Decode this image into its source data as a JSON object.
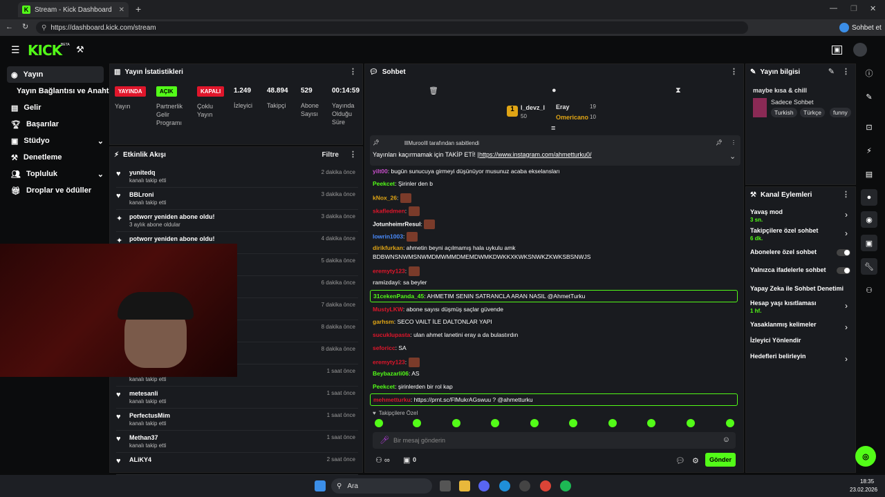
{
  "browser": {
    "tab_title": "Stream - Kick Dashboard",
    "url": "https://dashboard.kick.com/stream",
    "profile_label": "Sohbet et"
  },
  "header": {
    "logo": "KICK",
    "beta": "BETA"
  },
  "nav": {
    "items": [
      {
        "label": "Yayın"
      },
      {
        "label": "Yayın Bağlantısı ve Anahtarı"
      },
      {
        "label": "Gelir"
      },
      {
        "label": "Başarılar"
      },
      {
        "label": "Stüdyo"
      },
      {
        "label": "Denetleme"
      },
      {
        "label": "Topluluk"
      },
      {
        "label": "Droplar ve ödüller"
      }
    ]
  },
  "stats": {
    "title": "Yayın İstatistikleri",
    "b1": "YAYINDA",
    "b2": "AÇIK",
    "b3": "KAPALI",
    "l1": "Yayın",
    "l2": "Partnerlik Gelir Programı",
    "l3": "Çoklu Yayın",
    "v4": "1.249",
    "l4": "İzleyici",
    "v5": "48.894",
    "l5": "Takipçi",
    "v6": "529",
    "l6": "Abone Sayısı",
    "v7": "00:14:59",
    "l7": "Yayında Olduğu Süre"
  },
  "activity": {
    "title": "Etkinlik Akışı",
    "filter": "Filtre",
    "items": [
      {
        "name": "yunitedq",
        "sub": "kanalı takip etti",
        "time": "2 dakika önce"
      },
      {
        "name": "BBLroni",
        "sub": "kanalı takip etti",
        "time": "3 dakika önce"
      },
      {
        "name": "potworr yeniden abone oldu!",
        "sub": "3 aylık abone oldular",
        "time": "3 dakika önce"
      },
      {
        "name": "potworr yeniden abone oldu!",
        "sub": "",
        "time": "4 dakika önce"
      },
      {
        "name": "",
        "sub": "",
        "time": "5 dakika önce"
      },
      {
        "name": "",
        "sub": "",
        "time": "6 dakika önce"
      },
      {
        "name": "",
        "sub": "",
        "time": "7 dakika önce"
      },
      {
        "name": "",
        "sub": "",
        "time": "8 dakika önce"
      },
      {
        "name": "",
        "sub": "",
        "time": "8 dakika önce"
      },
      {
        "name": "",
        "sub": "kanalı takip etti",
        "time": "1 saat önce"
      },
      {
        "name": "metesanli",
        "sub": "kanalı takip etti",
        "time": "1 saat önce"
      },
      {
        "name": "PerfectusMim",
        "sub": "kanalı takip etti",
        "time": "1 saat önce"
      },
      {
        "name": "Methan37",
        "sub": "kanalı takip etti",
        "time": "1 saat önce"
      },
      {
        "name": "ALiKY4",
        "sub": "",
        "time": "2 saat önce"
      }
    ]
  },
  "chat": {
    "title": "Sohbet",
    "top": [
      {
        "name": "l_devz_l",
        "val": "50"
      },
      {
        "name": "Eray",
        "val": "19"
      },
      {
        "name": "Omericano",
        "val": "10"
      }
    ],
    "pin_by": "lllMurooIll tarafından sabitlendi",
    "pin_text": "Yayınları kaçırmamak için TAKİP ETİ! |",
    "pin_link": "https://www.instagram.com/ahmetturku0/",
    "messages": [
      {
        "u": "yilt00",
        "t": "bugün sunucuya girmeyi düşünüyor musunuz acaba ekselansları"
      },
      {
        "u": "Peekcet",
        "t": "Şirinler den b"
      },
      {
        "u": "kNox_26",
        "t": ""
      },
      {
        "u": "skafledmen",
        "t": ""
      },
      {
        "u": "JotunheimrResul",
        "t": ""
      },
      {
        "u": "lowrin1003",
        "t": ""
      },
      {
        "u": "dirikfurkan",
        "t": "ahmetin beyni açılmamış hala uykulu amk"
      },
      {
        "u": "",
        "t": "BDBWNSNWMSNWMDMWMMDMEMDWMKDWKKXKWKSNWKZKWKSBSNWJS"
      },
      {
        "u": "eremyty123",
        "t": ""
      },
      {
        "u": "ramizdayi",
        "t": "sa beyler"
      },
      {
        "u": "31cekenPanda_45",
        "t": "AHMETIM SENIN SATRANCLA ARAN NASIL @AhmetTurku"
      },
      {
        "u": "MustyLKW",
        "t": "abone sayısı düşmüş saçlar güvende"
      },
      {
        "u": "garhsm",
        "t": "SECO VAILT İLE DALTONLAR YAPI"
      },
      {
        "u": "sucuklupasta",
        "t": "ulan ahmet lanetini eray a da bulastırdın"
      },
      {
        "u": "seforicc",
        "t": "SA"
      },
      {
        "u": "eremyty123",
        "t": ""
      },
      {
        "u": "Beybazarli06",
        "t": "AS"
      },
      {
        "u": "Peekcet",
        "t": "şirinlerden bir rol kap"
      },
      {
        "u": "mehmetturku",
        "t": "https://prnt.sc/FlMukrAGswuu ? @ahmetturku"
      }
    ],
    "followers_only": "Takipçilere Özel",
    "placeholder": "Bir mesaj gönderin",
    "send": "Gönder",
    "count": "0"
  },
  "info": {
    "title": "Yayın bilgisi",
    "stream_title": "maybe kısa & chill",
    "category": "Sadece Sohbet",
    "tags": [
      "Turkish",
      "Türkçe",
      "funny"
    ]
  },
  "actions": {
    "title": "Kanal Eylemleri",
    "items": [
      {
        "label": "Yavaş mod",
        "sub": "3 sn."
      },
      {
        "label": "Takipçilere özel sohbet",
        "sub": "6 dk."
      },
      {
        "label": "Abonelere özel sohbet",
        "sub": ""
      },
      {
        "label": "Yalnızca ifadelerle sohbet",
        "sub": ""
      },
      {
        "label": "Yapay Zeka ile Sohbet Denetimi",
        "sub": ""
      },
      {
        "label": "Hesap yaşı kısıtlaması",
        "sub": "1 hf."
      },
      {
        "label": "Yasaklanmış kelimeler",
        "sub": ""
      },
      {
        "label": "İzleyici Yönlendir",
        "sub": ""
      },
      {
        "label": "Hedefleri belirleyin",
        "sub": ""
      }
    ]
  },
  "taskbar": {
    "search": "Ara",
    "time": "18:35",
    "date": "23.02.2026"
  },
  "colors": {
    "accent": "#53fc18",
    "live": "#e0162b"
  }
}
